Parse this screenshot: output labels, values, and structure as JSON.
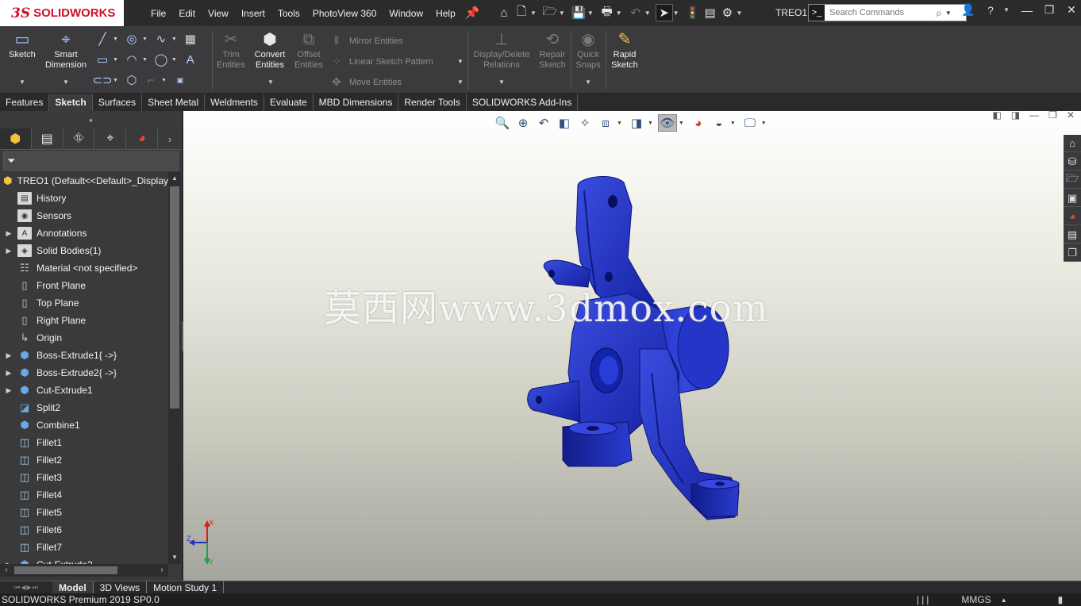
{
  "app": {
    "logo_mark": "3S",
    "logo_text": "SOLIDWORKS",
    "document_name": "TREO1"
  },
  "menu": [
    "File",
    "Edit",
    "View",
    "Insert",
    "Tools",
    "PhotoView 360",
    "Window",
    "Help"
  ],
  "search": {
    "placeholder": "Search Commands"
  },
  "command_manager": {
    "sketch": "Sketch",
    "smart_dimension": "Smart Dimension",
    "trim_entities": "Trim Entities",
    "convert_entities": "Convert Entities",
    "offset_entities": "Offset Entities",
    "mirror_entities": "Mirror Entities",
    "linear_sketch_pattern": "Linear Sketch Pattern",
    "move_entities": "Move Entities",
    "display_delete_relations": "Display/Delete Relations",
    "repair_sketch": "Repair Sketch",
    "quick_snaps": "Quick Snaps",
    "rapid_sketch": "Rapid Sketch"
  },
  "tabs": [
    "Features",
    "Sketch",
    "Surfaces",
    "Sheet Metal",
    "Weldments",
    "Evaluate",
    "MBD Dimensions",
    "Render Tools",
    "SOLIDWORKS Add-Ins"
  ],
  "active_tab": "Sketch",
  "feature_tree": {
    "root": "TREO1  (Default<<Default>_Display",
    "items": [
      {
        "label": "History",
        "icon": "folder-icon",
        "expandable": false
      },
      {
        "label": "Sensors",
        "icon": "sensor-icon",
        "expandable": false
      },
      {
        "label": "Annotations",
        "icon": "annotation-icon",
        "expandable": true
      },
      {
        "label": "Solid Bodies(1)",
        "icon": "solid-bodies-icon",
        "expandable": true
      },
      {
        "label": "Material <not specified>",
        "icon": "material-icon",
        "expandable": false
      },
      {
        "label": "Front Plane",
        "icon": "plane-icon",
        "expandable": false
      },
      {
        "label": "Top Plane",
        "icon": "plane-icon",
        "expandable": false
      },
      {
        "label": "Right Plane",
        "icon": "plane-icon",
        "expandable": false
      },
      {
        "label": "Origin",
        "icon": "origin-icon",
        "expandable": false
      },
      {
        "label": "Boss-Extrude1{ ->}",
        "icon": "extrude-icon",
        "expandable": true
      },
      {
        "label": "Boss-Extrude2{ ->}",
        "icon": "extrude-icon",
        "expandable": true
      },
      {
        "label": "Cut-Extrude1",
        "icon": "cut-extrude-icon",
        "expandable": true
      },
      {
        "label": "Split2",
        "icon": "split-icon",
        "expandable": false
      },
      {
        "label": "Combine1",
        "icon": "combine-icon",
        "expandable": false
      },
      {
        "label": "Fillet1",
        "icon": "fillet-icon",
        "expandable": false
      },
      {
        "label": "Fillet2",
        "icon": "fillet-icon",
        "expandable": false
      },
      {
        "label": "Fillet3",
        "icon": "fillet-icon",
        "expandable": false
      },
      {
        "label": "Fillet4",
        "icon": "fillet-icon",
        "expandable": false
      },
      {
        "label": "Fillet5",
        "icon": "fillet-icon",
        "expandable": false
      },
      {
        "label": "Fillet6",
        "icon": "fillet-icon",
        "expandable": false
      },
      {
        "label": "Fillet7",
        "icon": "fillet-icon",
        "expandable": false
      },
      {
        "label": "Cut-Extrude2",
        "icon": "cut-extrude-icon",
        "expandable": true
      }
    ]
  },
  "viewport": {
    "watermark": "莫西网www.3dmox.com",
    "model_color": "#1f2fb8",
    "triad_labels": {
      "x": "X",
      "y": "Y",
      "z": "Z"
    }
  },
  "bottom_tabs": [
    "Model",
    "3D Views",
    "Motion Study 1"
  ],
  "active_bottom_tab": "Model",
  "status": {
    "product": "SOLIDWORKS Premium 2019 SP0.0",
    "units": "MMGS"
  },
  "colors": {
    "chrome_dark": "#2b2b2b",
    "panel": "#3a3a3c",
    "logo_red": "#d0102a",
    "model_blue": "#1f2fb8"
  }
}
